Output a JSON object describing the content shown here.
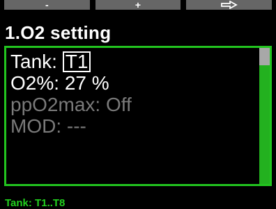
{
  "softkeys": {
    "left_label": "-",
    "middle_label": "+",
    "right_icon": "right-arrow-icon"
  },
  "title": "1.O2 setting",
  "settings": {
    "tank_label": "Tank:",
    "tank_value": "T1",
    "o2_label": "O2%:",
    "o2_value": "27 %",
    "ppo2_label": "ppO2max:",
    "ppo2_value": "Off",
    "mod_label": "MOD:",
    "mod_value": "---"
  },
  "scroll": {
    "position_fraction": 0.0
  },
  "footer_hint": "Tank: T1..T8",
  "colors": {
    "accent_green": "#22c41f",
    "dim_text": "#7a7a7a",
    "softkey_bg": "#666666"
  }
}
